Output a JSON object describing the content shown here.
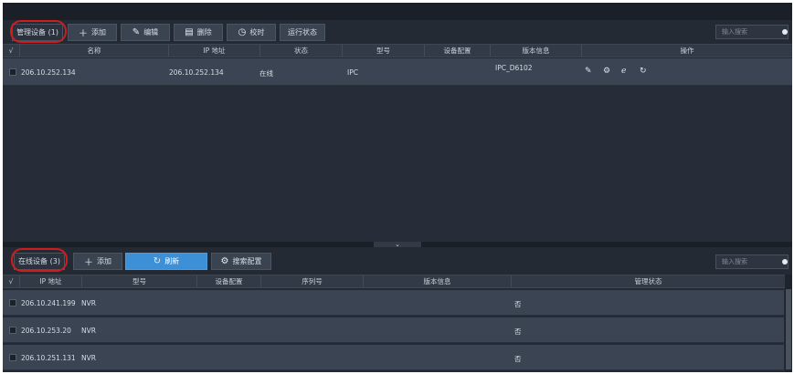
{
  "top_panel": {
    "tab_label": "管理设备 (1)",
    "buttons": {
      "add": "添加",
      "edit": "编辑",
      "delete": "删除",
      "timesync": "校时",
      "runstate": "运行状态"
    },
    "search_placeholder": "输入搜索",
    "columns": {
      "check": "√",
      "name": "名称",
      "ip": "IP 地址",
      "status": "状态",
      "model": "型号",
      "config": "设备配置",
      "version": "版本信息",
      "ops": "操作"
    },
    "rows": [
      {
        "name": "206.10.252.134",
        "ip": "206.10.252.134",
        "status": "在线",
        "model": "IPC",
        "version": "IPC_D6102"
      }
    ],
    "icons": [
      "pencil-icon",
      "gear-icon",
      "browser-e-icon",
      "refresh-icon"
    ]
  },
  "divider": {
    "toggle_glyph": "⌄"
  },
  "bottom_panel": {
    "tab_label": "在线设备 (3)",
    "buttons": {
      "add": "添加",
      "refresh": "刷新",
      "search_config": "搜索配置"
    },
    "search_placeholder": "输入搜索",
    "columns": {
      "check": "√",
      "ip": "IP 地址",
      "model": "型号",
      "config": "设备配置",
      "serial": "序列号",
      "version": "版本信息",
      "mgmt": "管理状态"
    },
    "rows": [
      {
        "ip": "206.10.241.199",
        "model": "NVR",
        "mgmt": "否"
      },
      {
        "ip": "206.10.253.20",
        "model": "NVR",
        "mgmt": "否"
      },
      {
        "ip": "206.10.251.131",
        "model": "NVR",
        "mgmt": "否"
      }
    ]
  },
  "colors": {
    "background": "#232a34",
    "row": "#3a4452",
    "accent_blue": "#3d8fd6",
    "highlight_red": "#d01c1c"
  }
}
